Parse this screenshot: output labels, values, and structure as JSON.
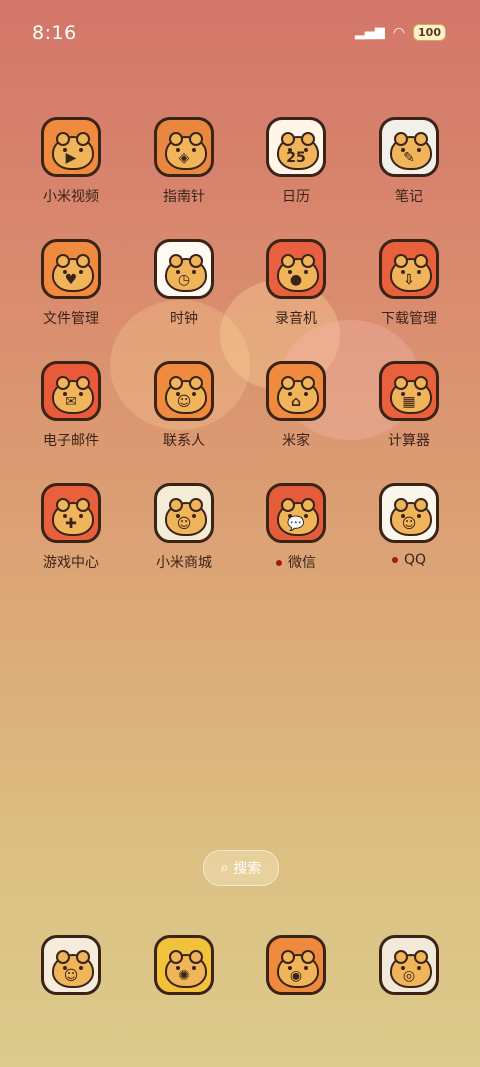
{
  "status": {
    "time": "8:16",
    "battery": "100"
  },
  "apps": [
    {
      "label": "小米视频",
      "icon": "video-play-icon",
      "glyph": "▶",
      "bg": "#ef8a3f"
    },
    {
      "label": "指南针",
      "icon": "compass-icon",
      "glyph": "◈",
      "bg": "#e98640"
    },
    {
      "label": "日历",
      "icon": "calendar-icon",
      "glyph": "25",
      "bg": "#fff6e8"
    },
    {
      "label": "笔记",
      "icon": "notes-icon",
      "glyph": "✎",
      "bg": "#f3f0ea"
    },
    {
      "label": "文件管理",
      "icon": "folder-icon",
      "glyph": "♥",
      "bg": "#ef8a3f"
    },
    {
      "label": "时钟",
      "icon": "clock-icon",
      "glyph": "◷",
      "bg": "#fffaf2"
    },
    {
      "label": "录音机",
      "icon": "recorder-icon",
      "glyph": "●",
      "bg": "#e8603f"
    },
    {
      "label": "下载管理",
      "icon": "download-icon",
      "glyph": "⇩",
      "bg": "#e9603c"
    },
    {
      "label": "电子邮件",
      "icon": "mail-icon",
      "glyph": "✉",
      "bg": "#e95a3a"
    },
    {
      "label": "联系人",
      "icon": "contacts-icon",
      "glyph": "☺",
      "bg": "#ef8a3f"
    },
    {
      "label": "米家",
      "icon": "home-icon",
      "glyph": "⌂",
      "bg": "#ef8a3f"
    },
    {
      "label": "计算器",
      "icon": "calculator-icon",
      "glyph": "▦",
      "bg": "#e9603c"
    },
    {
      "label": "游戏中心",
      "icon": "gamepad-icon",
      "glyph": "✚",
      "bg": "#e9603c"
    },
    {
      "label": "小米商城",
      "icon": "mall-icon",
      "glyph": "☺",
      "bg": "#f5ecd8"
    },
    {
      "label": "微信",
      "icon": "wechat-icon",
      "glyph": "💬",
      "bg": "#e45c3a"
    },
    {
      "label": "QQ",
      "icon": "qq-icon",
      "glyph": "☺",
      "bg": "#fbf6ec"
    }
  ],
  "notify_dots": [
    "微信",
    "QQ"
  ],
  "search": {
    "label": "搜索"
  },
  "dock": [
    {
      "icon": "phone-icon",
      "glyph": "☺",
      "bg": "#f6ecdc"
    },
    {
      "icon": "lantern-icon",
      "glyph": "✺",
      "bg": "#f2c33a"
    },
    {
      "icon": "camera-icon",
      "glyph": "◉",
      "bg": "#ee8a3e"
    },
    {
      "icon": "browser-icon",
      "glyph": "◎",
      "bg": "#f3e9da"
    }
  ]
}
